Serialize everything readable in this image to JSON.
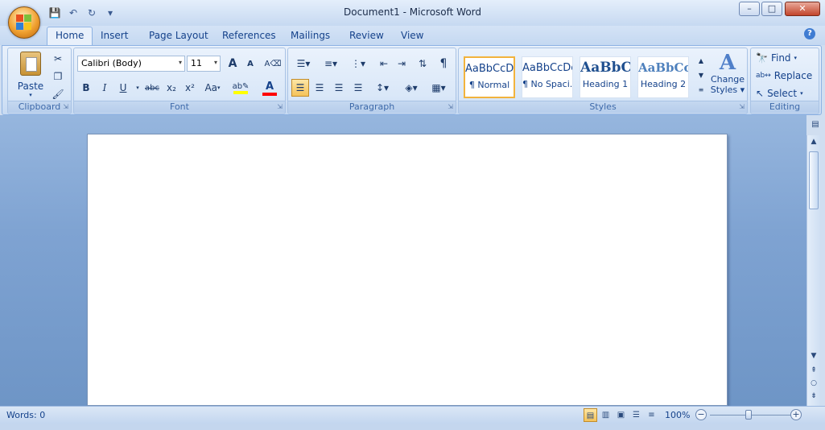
{
  "window": {
    "title": "Document1 - Microsoft Word"
  },
  "qat": {
    "items": [
      "save-icon",
      "undo-icon",
      "redo-icon",
      "customize-icon"
    ]
  },
  "tabs": [
    {
      "label": "Home",
      "active": true
    },
    {
      "label": "Insert"
    },
    {
      "label": "Page Layout"
    },
    {
      "label": "References"
    },
    {
      "label": "Mailings"
    },
    {
      "label": "Review"
    },
    {
      "label": "View"
    }
  ],
  "clipboard": {
    "label": "Clipboard",
    "paste": "Paste"
  },
  "font": {
    "label": "Font",
    "family": "Calibri (Body)",
    "size": "11",
    "bold": "B",
    "italic": "I",
    "underline": "U",
    "strike": "abc",
    "sub": "x₂",
    "sup": "x²",
    "case": "Aa",
    "grow": "A",
    "shrink": "A"
  },
  "paragraph": {
    "label": "Paragraph"
  },
  "styles": {
    "label": "Styles",
    "items": [
      {
        "preview": "AaBbCcDc",
        "name": "¶ Normal"
      },
      {
        "preview": "AaBbCcDc",
        "name": "¶ No Spaci..."
      },
      {
        "preview": "AaBbCc",
        "name": "Heading 1"
      },
      {
        "preview": "AaBbCc",
        "name": "Heading 2"
      }
    ],
    "change": "Change Styles",
    "change_line1": "Change",
    "change_line2": "Styles"
  },
  "editing": {
    "label": "Editing",
    "find": "Find",
    "replace": "Replace",
    "select": "Select"
  },
  "status": {
    "words": "Words: 0",
    "zoom": "100%"
  },
  "colors": {
    "accent": "#15428b",
    "highlight": "#ffff00",
    "font_color": "#ff0000",
    "office": "#f0a030"
  }
}
